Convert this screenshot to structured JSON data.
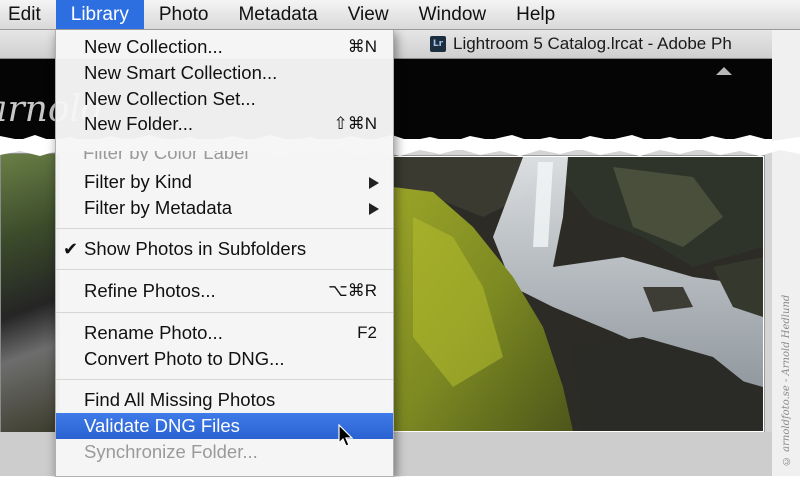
{
  "menubar": {
    "items": [
      "Edit",
      "Library",
      "Photo",
      "Metadata",
      "View",
      "Window",
      "Help"
    ],
    "active": "Library"
  },
  "window": {
    "title": "Lightroom 5 Catalog.lrcat - Adobe Ph",
    "app_icon": "Lr"
  },
  "identity_plate": "arnold",
  "credit": "© arnoldfoto.se - Arnold Hedlund",
  "menu": {
    "items": [
      {
        "label": "New Collection...",
        "shortcut": "⌘N"
      },
      {
        "label": "New Smart Collection...",
        "shortcut": ""
      },
      {
        "label": "New Collection Set...",
        "shortcut": ""
      },
      {
        "label": "New Folder...",
        "shortcut": "⇧⌘N"
      },
      {
        "label": "Filter by Kind",
        "shortcut": "",
        "submenu": true
      },
      {
        "label": "Filter by Metadata",
        "shortcut": "",
        "submenu": true
      },
      {
        "label": "Show Photos in Subfolders",
        "shortcut": "",
        "checked": true
      },
      {
        "label": "Refine Photos...",
        "shortcut": "⌥⌘R"
      },
      {
        "label": "Rename Photo...",
        "shortcut": "F2"
      },
      {
        "label": "Convert Photo to DNG...",
        "shortcut": ""
      },
      {
        "label": "Find All Missing Photos",
        "shortcut": ""
      },
      {
        "label": "Validate DNG Files",
        "shortcut": "",
        "selected": true
      },
      {
        "label": "Synchronize Folder...",
        "shortcut": "",
        "disabled": true
      }
    ],
    "partial_item": "Filter by Color Label"
  },
  "colors": {
    "menu_highlight": "#2d6ee0",
    "menubar_bg": "#e8e8e8",
    "dark_panel": "#050505"
  }
}
